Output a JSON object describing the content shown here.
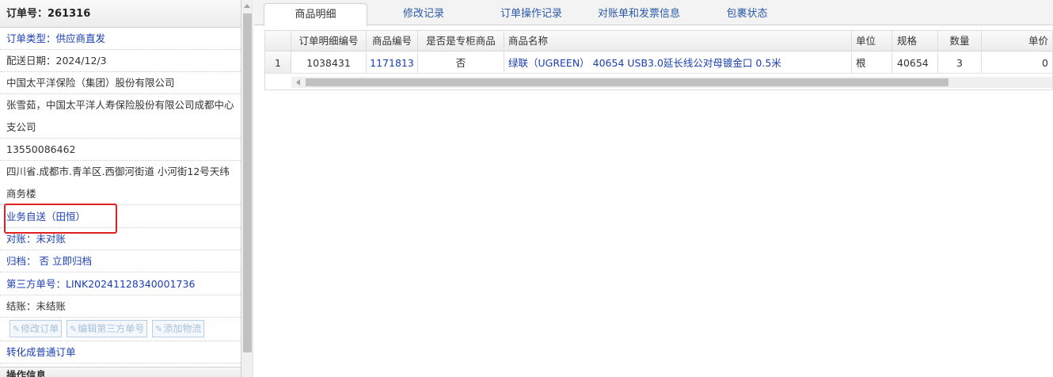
{
  "order": {
    "header": "订单号：261316",
    "type": "订单类型：供应商直发",
    "delivery_date": "配送日期：2024/12/3",
    "company": "中国太平洋保险（集团）股份有限公司",
    "contact": "张雪茹，中国太平洋人寿保险股份有限公司成都中心支公司",
    "phone": "13550086462",
    "address": "四川省.成都市.青羊区.西御河街道 小河街12号天纬商务楼",
    "delivery_mode": "业务自送（田恒）",
    "reconcile": "对账：未对账",
    "archive": "归档： 否 立即归档",
    "third_party": "第三方单号：LINK20241128340001736",
    "settlement": "结账：未结账",
    "convert_link": "转化成普通订单",
    "next_section": "操作信息"
  },
  "buttons": {
    "edit_order": "修改订单",
    "edit_third_party": "编辑第三方单号",
    "add_logistics": "添加物流"
  },
  "tabs": [
    "商品明细",
    "修改记录",
    "订单操作记录",
    "对账单和发票信息",
    "包裹状态"
  ],
  "grid": {
    "columns": [
      "订单明细编号",
      "商品编号",
      "是否是专柜商品",
      "商品名称",
      "单位",
      "规格",
      "数量",
      "单价"
    ],
    "rows": [
      {
        "rownum": "1",
        "detail_id": "1038431",
        "product_code": "1171813",
        "exclusive": "否",
        "name": "绿联（UGREEN） 40654 USB3.0延长线公对母镀金口 0.5米",
        "unit": "根",
        "spec": "40654",
        "qty": "3",
        "price": "0"
      }
    ]
  },
  "colors": {
    "link": "#1a3fb0",
    "highlight": "#e02020"
  }
}
